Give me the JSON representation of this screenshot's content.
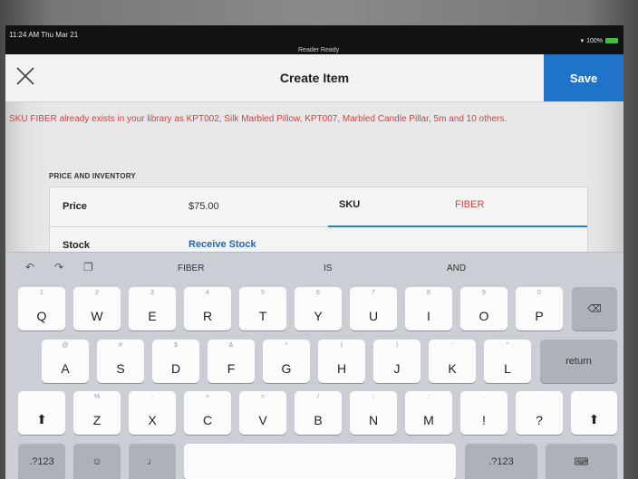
{
  "status": {
    "time": "11:24 AM  Thu Mar 21",
    "center": "Reader Ready",
    "battery": "100%"
  },
  "nav": {
    "title": "Create Item",
    "save_label": "Save"
  },
  "error_message": "SKU FIBER already exists in your library as KPT002, Silk Marbled Pillow, KPT007, Marbled Candle Pillar, 5m and 10 others.",
  "form": {
    "section_title": "PRICE AND INVENTORY",
    "price_label": "Price",
    "price_value": "$75.00",
    "sku_label": "SKU",
    "sku_value": "FIBER",
    "stock_label": "Stock",
    "receive_stock_label": "Receive Stock"
  },
  "keyboard": {
    "predictions": [
      "FIBER",
      "IS",
      "AND"
    ],
    "row1": [
      {
        "key": "Q",
        "hint": "1"
      },
      {
        "key": "W",
        "hint": "2"
      },
      {
        "key": "E",
        "hint": "3"
      },
      {
        "key": "R",
        "hint": "4"
      },
      {
        "key": "T",
        "hint": "5"
      },
      {
        "key": "Y",
        "hint": "6"
      },
      {
        "key": "U",
        "hint": "7"
      },
      {
        "key": "I",
        "hint": "8"
      },
      {
        "key": "O",
        "hint": "9"
      },
      {
        "key": "P",
        "hint": "0"
      }
    ],
    "row2": [
      {
        "key": "A",
        "hint": "@"
      },
      {
        "key": "S",
        "hint": "#"
      },
      {
        "key": "D",
        "hint": "$"
      },
      {
        "key": "F",
        "hint": "&"
      },
      {
        "key": "G",
        "hint": "*"
      },
      {
        "key": "H",
        "hint": "("
      },
      {
        "key": "J",
        "hint": ")"
      },
      {
        "key": "K",
        "hint": "'"
      },
      {
        "key": "L",
        "hint": "\""
      }
    ],
    "row3": [
      {
        "key": "Z",
        "hint": "%"
      },
      {
        "key": "X",
        "hint": "-"
      },
      {
        "key": "C",
        "hint": "+"
      },
      {
        "key": "V",
        "hint": "="
      },
      {
        "key": "B",
        "hint": "/"
      },
      {
        "key": "N",
        "hint": ";"
      },
      {
        "key": "M",
        "hint": ":"
      },
      {
        "key": "!",
        "hint": ","
      },
      {
        "key": "?",
        "hint": "."
      }
    ],
    "return_label": "return",
    "numbers_label": ".?123",
    "numbers_label_right": ".?123"
  }
}
